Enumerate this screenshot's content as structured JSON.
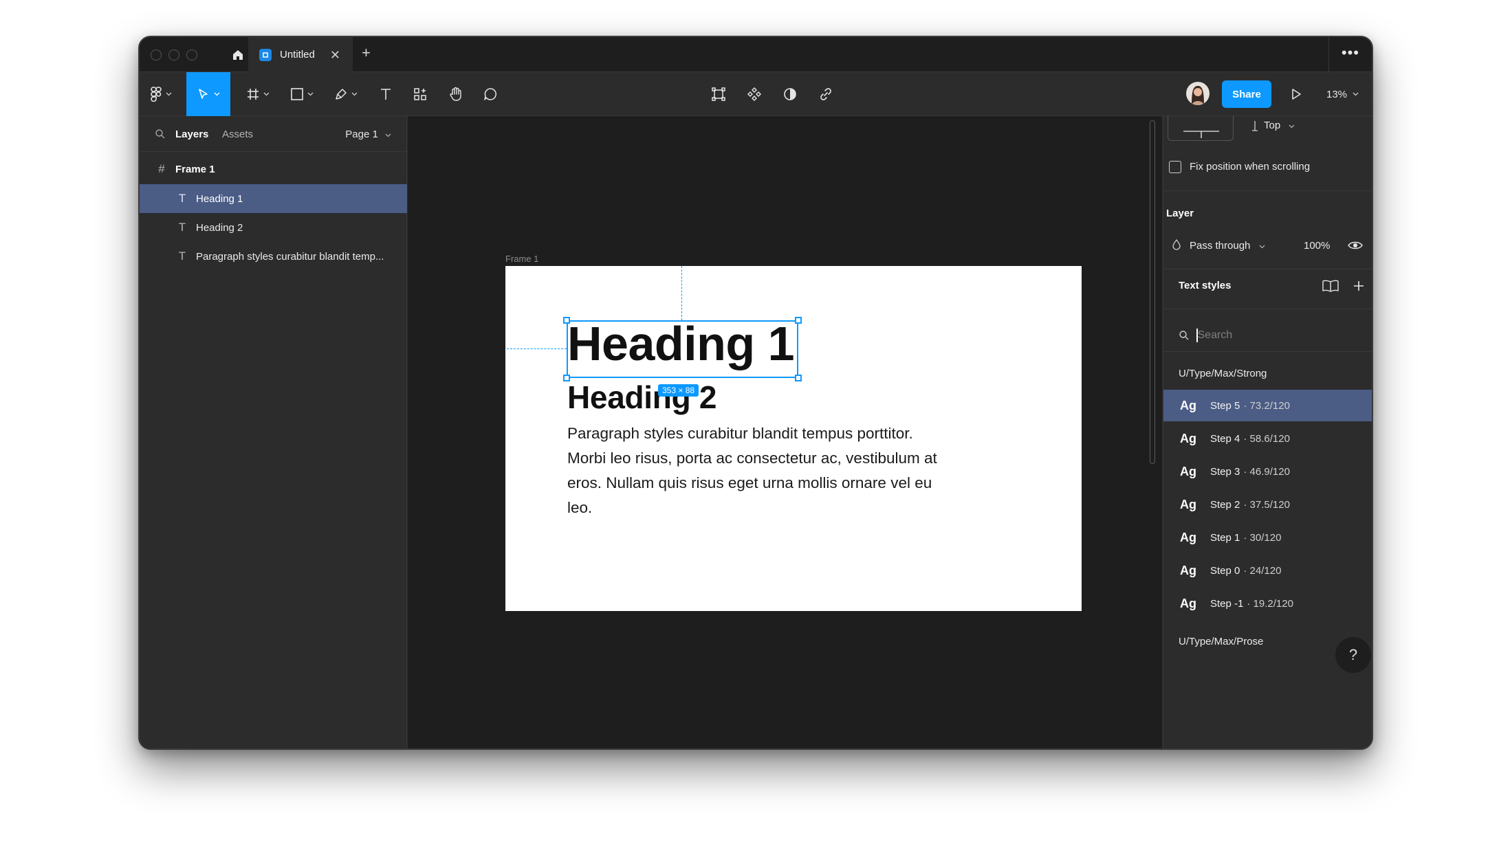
{
  "tab": {
    "title": "Untitled"
  },
  "toolbar": {
    "share_label": "Share",
    "zoom_label": "13%"
  },
  "left_panel": {
    "tabs": [
      "Layers",
      "Assets"
    ],
    "page_label": "Page 1",
    "frame_name": "Frame 1",
    "layers": [
      "Heading 1",
      "Heading 2",
      "Paragraph styles curabitur blandit temp..."
    ]
  },
  "canvas": {
    "frame_label": "Frame 1",
    "heading1": "Heading 1",
    "heading2": "Heading 2",
    "paragraph": "Paragraph styles curabitur blandit tempus porttitor. Morbi leo risus, porta ac consectetur ac, vestibulum at eros. Nullam quis risus eget urna mollis ornare vel eu leo.",
    "selection_dimensions": "353 × 88"
  },
  "right_panel": {
    "constraint_vertical": "Top",
    "fix_position_label": "Fix position when scrolling",
    "layer_heading": "Layer",
    "blend_mode": "Pass through",
    "opacity": "100%",
    "text_styles_heading": "Text styles",
    "search_placeholder": "Search",
    "group1": "U/Type/Max/Strong",
    "styles": [
      {
        "icon": "Ag",
        "name": "Step 5",
        "meta": "· 73.2/120"
      },
      {
        "icon": "Ag",
        "name": "Step 4",
        "meta": "· 58.6/120"
      },
      {
        "icon": "Ag",
        "name": "Step 3",
        "meta": "· 46.9/120"
      },
      {
        "icon": "Ag",
        "name": "Step 2",
        "meta": "· 37.5/120"
      },
      {
        "icon": "Ag",
        "name": "Step 1",
        "meta": "· 30/120"
      },
      {
        "icon": "Ag",
        "name": "Step 0",
        "meta": "· 24/120"
      },
      {
        "icon": "Ag",
        "name": "Step -1",
        "meta": "· 19.2/120"
      }
    ],
    "group2": "U/Type/Max/Prose",
    "help_label": "?"
  },
  "colors": {
    "accent": "#0d99ff",
    "selection": "#4b5c85",
    "panel": "#2c2c2c",
    "canvas": "#1e1e1e"
  }
}
